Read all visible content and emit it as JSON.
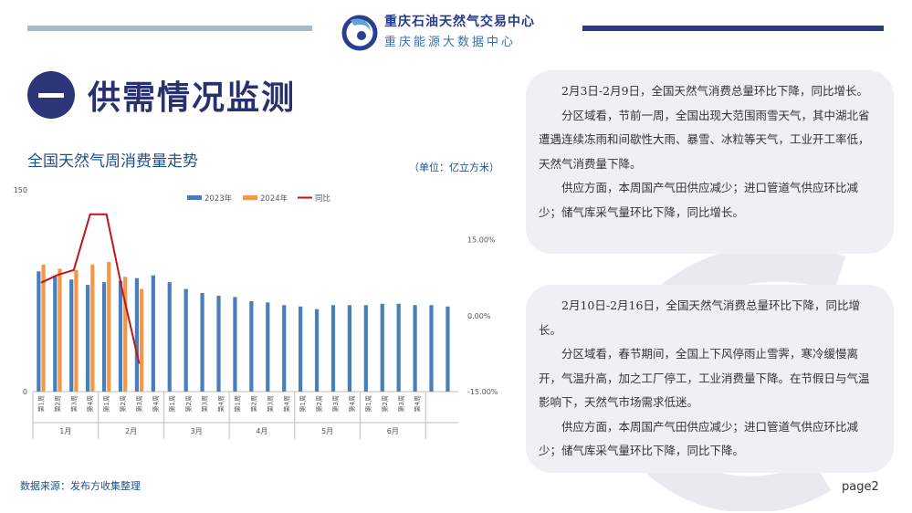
{
  "header": {
    "org_name": "重庆石油天然气交易中心",
    "org_sub": "重庆能源大数据中心"
  },
  "section": {
    "title": "供需情况监测"
  },
  "chart_title": "全国天然气周消费量走势",
  "chart_unit": "（单位：亿立方米）",
  "source_note": "数据来源：发布方收集整理",
  "page_label": "page2",
  "colors": {
    "series_2023": "#4a7ebb",
    "series_2024": "#f79646",
    "yoy_line": "#c0151a",
    "navy": "#2c3577"
  },
  "chart_data": {
    "type": "bar",
    "ylim": [
      0,
      150
    ],
    "y_ticks": [
      "150",
      "0"
    ],
    "y2lim": [
      -0.15,
      0.25
    ],
    "y2_ticks": [
      "15.00%",
      "0.00%",
      "-15.00%"
    ],
    "legend_position": "top",
    "categories": [
      "第1周",
      "第2周",
      "第3周",
      "第4周",
      "第1周",
      "第2周",
      "第3周",
      "第4周",
      "第1周",
      "第2周",
      "第3周",
      "第4周",
      "第1周",
      "第2周",
      "第3周",
      "第4周",
      "第1周",
      "第2周",
      "第3周",
      "第4周",
      "第1周",
      "第2周",
      "第3周",
      "第4周"
    ],
    "months": [
      {
        "label": "1月",
        "span": 4
      },
      {
        "label": "2月",
        "span": 4
      },
      {
        "label": "3月",
        "span": 4
      },
      {
        "label": "4月",
        "span": 4
      },
      {
        "label": "5月",
        "span": 4
      },
      {
        "label": "6月",
        "span": 4
      }
    ],
    "series": [
      {
        "name": "2023年",
        "type": "bar",
        "values": [
          89,
          86,
          83,
          79,
          81,
          82,
          84,
          86,
          81,
          76,
          73,
          71,
          70,
          67,
          66,
          64,
          63,
          61,
          64,
          64,
          64,
          65,
          65,
          64,
          64,
          63
        ]
      },
      {
        "name": "2024年",
        "type": "bar",
        "values": [
          94,
          91,
          90,
          94,
          96,
          85,
          76
        ]
      },
      {
        "name": "同比",
        "type": "line",
        "axis": "secondary",
        "values": [
          0.065,
          0.08,
          0.09,
          0.2,
          0.2,
          0.045,
          -0.095
        ]
      }
    ]
  },
  "card1": {
    "p1": "2月3日-2月9日，全国天然气消费总量环比下降，同比增长。",
    "p2": "分区域看，节前一周，全国出现大范围雨雪天气，其中湖北省遭遇连续冻雨和间歇性大雨、暴雪、冰粒等天气，工业开工率低，天然气消费量下降。",
    "p3": "供应方面，本周国产气田供应减少；进口管道气供应环比减少；储气库采气量环比下降，同比增长。"
  },
  "card2": {
    "p1": "2月10日-2月16日，全国天然气消费总量环比下降，同比增长。",
    "p2": "分区域看，春节期间，全国上下风停雨止雪霁，寒冷缓慢离开，气温升高，加之工厂停工，工业消费量下降。在节假日与气温影响下，天然气市场需求低迷。",
    "p3": "供应方面，本周国产气田供应减少；进口管道气供应环比减少；储气库采气量环比下降，同比下降。"
  }
}
